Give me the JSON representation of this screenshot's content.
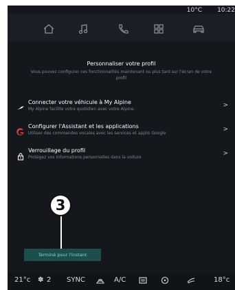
{
  "status": {
    "temperature": "10°C",
    "time": "10:22"
  },
  "top_nav": {
    "items": [
      "home-icon",
      "music-icon",
      "phone-icon",
      "apps-icon",
      "car-icon"
    ]
  },
  "page": {
    "title": "Personnaliser votre profil",
    "subtitle_line1": "Vous pouvez configurer ces fonctionnalités maintenant ou plus tard sur l'écran de votre",
    "subtitle_line2": "profil"
  },
  "menu": {
    "items": [
      {
        "icon": "alpine-logo-icon",
        "title": "Connecter votre véhicule à My Alpine",
        "desc": "My Alpine facilite votre quotidien avec votre Alpine."
      },
      {
        "icon": "google-icon",
        "title": "Configurer l'Assistant et les applications",
        "desc": "Utiliser des commandes vocales avec les services et applis Google"
      },
      {
        "icon": "lock-icon",
        "title": "Verrouillage du profil",
        "desc": "Protégez vos informations personnelles dans la voiture"
      }
    ]
  },
  "callout": {
    "number": "3"
  },
  "done_button": {
    "label": "Terminé pour l'instant"
  },
  "bottom_bar": {
    "temp_left": "21°c",
    "fan_speed": "2",
    "sync": "SYNC",
    "ac": "A/C",
    "temp_right": "18°c"
  },
  "colors": {
    "screen_bg": "#14171c",
    "accent": "#1e4e4c",
    "accent_text": "#7fd9c9"
  }
}
